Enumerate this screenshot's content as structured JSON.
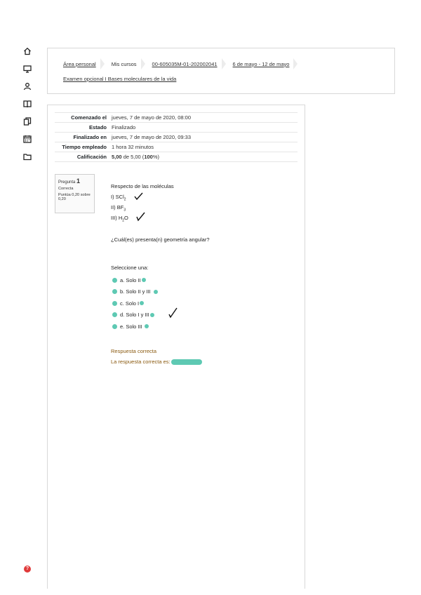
{
  "nav": {
    "icons": [
      "home-icon",
      "desktop-icon",
      "people-icon",
      "book-icon",
      "documents-icon",
      "calendar-icon",
      "folder-icon"
    ],
    "help_icon_symbol": "?"
  },
  "breadcrumb": {
    "items": [
      "Área personal",
      "Mis cursos",
      "00-605035M-01-202002041",
      "6 de mayo - 12 de mayo"
    ],
    "quiz_link": "Examen opcional I  Bases moleculares de la vida"
  },
  "summary": {
    "started_label": "Comenzado el",
    "started_value": "jueves, 7 de mayo de 2020, 08:00",
    "state_label": "Estado",
    "state_value": "Finalizado",
    "finished_label": "Finalizado en",
    "finished_value": "jueves, 7 de mayo de 2020, 09:33",
    "time_label": "Tiempo empleado",
    "time_value": "1 hora 32 minutos",
    "grade_label": "Calificación",
    "grade_score": "5,00",
    "grade_mid": " de 5,00 (",
    "grade_pct": "100",
    "grade_end": "%)"
  },
  "question_info": {
    "label": "Pregunta",
    "number": "1",
    "status": "Correcta",
    "points": "Puntúa 0,20 sobre 0,20"
  },
  "question": {
    "intro": "Respecto de las moléculas",
    "m1_prefix": "I) SCl",
    "m1_sub": "2",
    "m2_prefix": "II) BF",
    "m2_sub": "3",
    "m3_prefix": "III) H",
    "m3_sub": "2",
    "m3_suffix": "O",
    "prompt": "¿Cuál(es) presenta(n) geometría angular?",
    "select_label": "Seleccione una:",
    "options": [
      "a. Solo II",
      "b. Solo II y III",
      "c. Solo I",
      "d. Solo I y III",
      "e. Solo III"
    ]
  },
  "feedback": {
    "result": "Respuesta correcta",
    "answer_prefix": "La respuesta correcta es:"
  },
  "colors": {
    "highlight": "#5ec9b3",
    "feedback_text": "#8a5a10",
    "help": "#e03a3a"
  }
}
